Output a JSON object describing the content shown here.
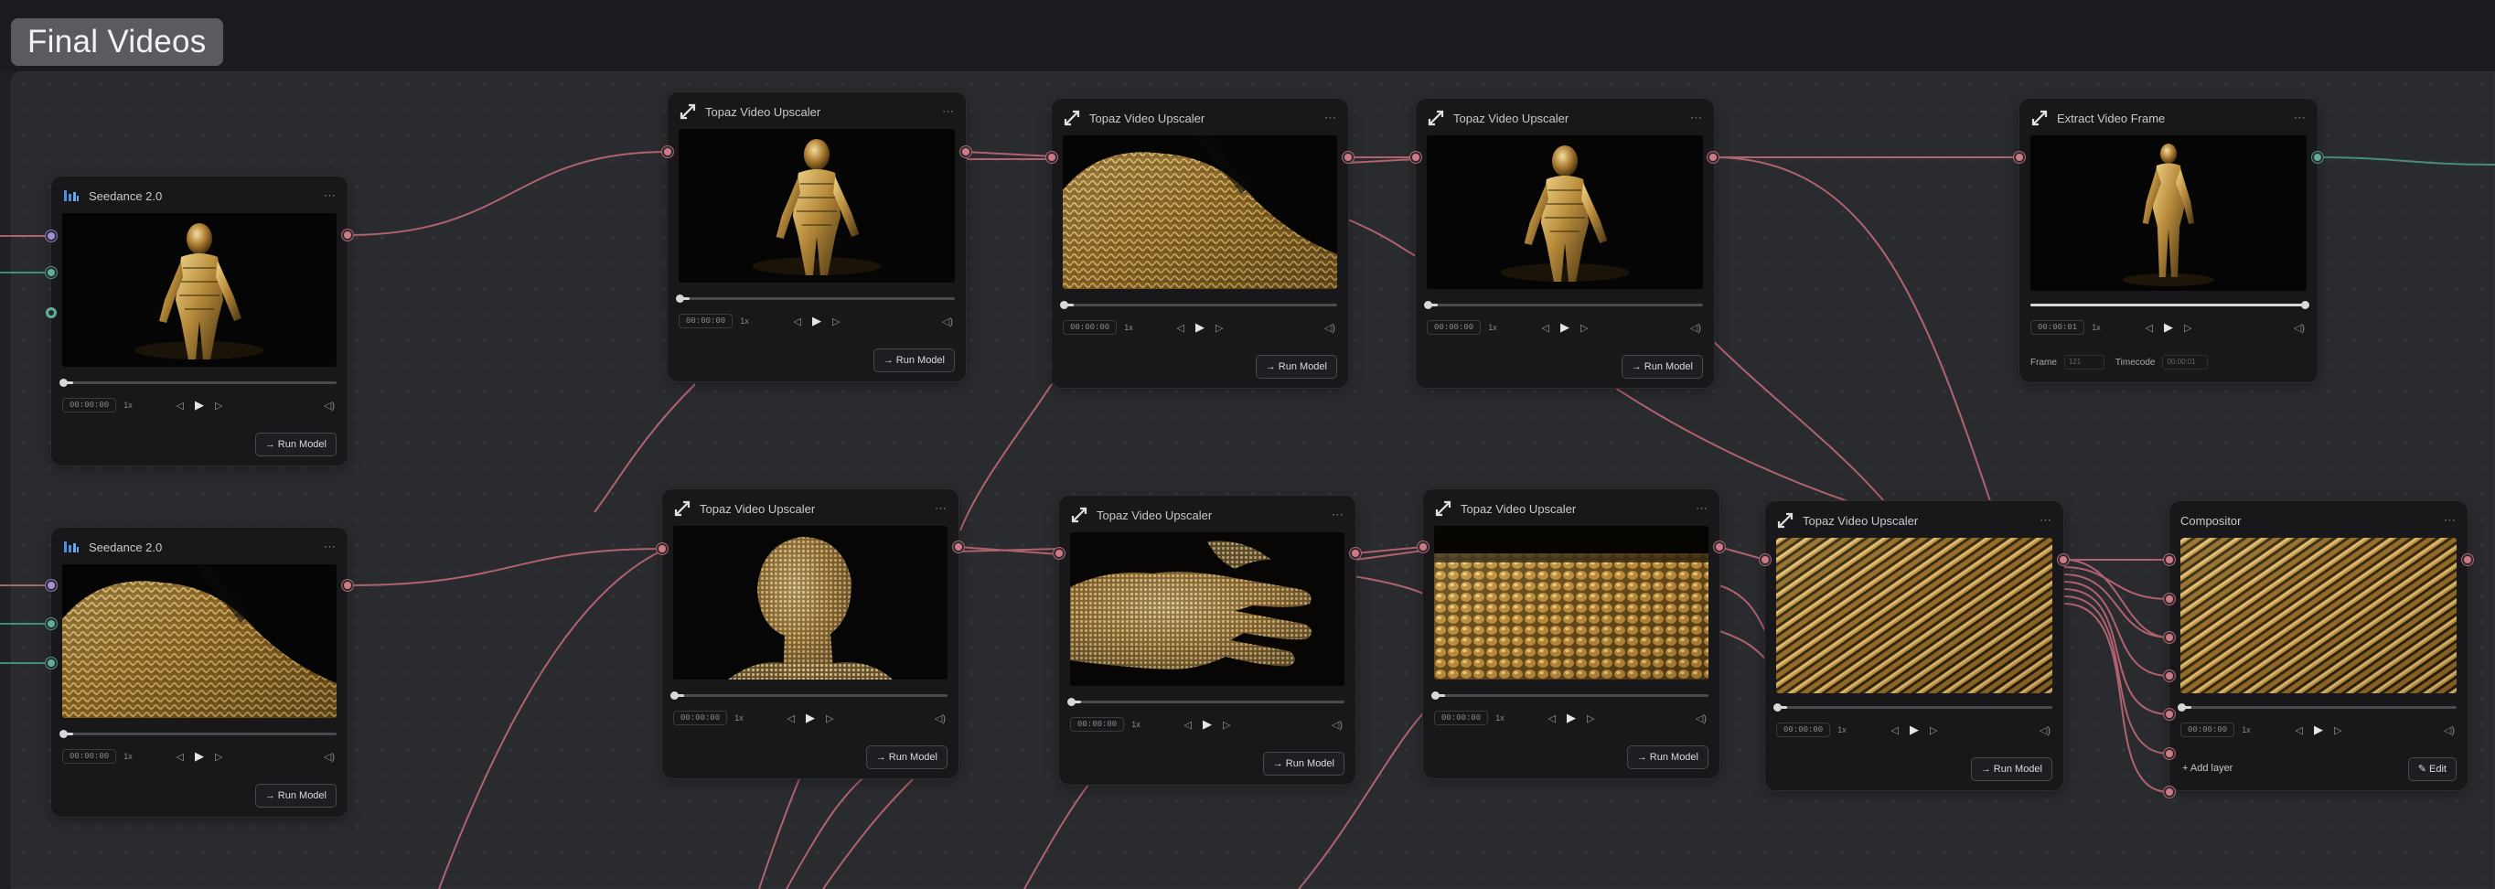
{
  "group": {
    "title": "Final Videos"
  },
  "nodes": [
    {
      "id": "seedance-1",
      "title": "Seedance 2.0",
      "icon": "bar-chart-icon",
      "time": "00:00:00",
      "speed": "1x",
      "button": "→ Run Model",
      "scene": "figure"
    },
    {
      "id": "seedance-2",
      "title": "Seedance 2.0",
      "icon": "bar-chart-icon",
      "time": "00:00:00",
      "speed": "1x",
      "button": "→ Run Model",
      "scene": "shoulder"
    },
    {
      "id": "topaz-1",
      "title": "Topaz Video Upscaler",
      "icon": "upscale-icon",
      "time": "00:00:00",
      "speed": "1x",
      "button": "→ Run Model",
      "scene": "figure"
    },
    {
      "id": "topaz-2",
      "title": "Topaz Video Upscaler",
      "icon": "upscale-icon",
      "time": "00:00:00",
      "speed": "1x",
      "button": "→ Run Model",
      "scene": "shoulder"
    },
    {
      "id": "topaz-3",
      "title": "Topaz Video Upscaler",
      "icon": "upscale-icon",
      "time": "00:00:00",
      "speed": "1x",
      "button": "→ Run Model",
      "scene": "figure"
    },
    {
      "id": "topaz-4",
      "title": "Topaz Video Upscaler",
      "icon": "upscale-icon",
      "time": "00:00:00",
      "speed": "1x",
      "button": "→ Run Model",
      "scene": "head"
    },
    {
      "id": "topaz-5",
      "title": "Topaz Video Upscaler",
      "icon": "upscale-icon",
      "time": "00:00:00",
      "speed": "1x",
      "button": "→ Run Model",
      "scene": "hand"
    },
    {
      "id": "topaz-6",
      "title": "Topaz Video Upscaler",
      "icon": "upscale-icon",
      "time": "00:00:00",
      "speed": "1x",
      "button": "→ Run Model",
      "scene": "texture"
    },
    {
      "id": "topaz-7",
      "title": "Topaz Video Upscaler",
      "icon": "upscale-icon",
      "time": "00:00:00",
      "speed": "1x",
      "button": "→ Run Model",
      "scene": "weave"
    },
    {
      "id": "extract",
      "title": "Extract Video Frame",
      "icon": "upscale-icon",
      "time": "00:00:01",
      "speed": "1x",
      "frame_label": "Frame",
      "frame_value": "121",
      "timecode_label": "Timecode",
      "timecode_value": "00:00:01",
      "scene": "figure-full"
    },
    {
      "id": "compositor",
      "title": "Compositor",
      "time": "00:00:00",
      "speed": "1x",
      "add_layer": "+ Add layer",
      "edit_button": "✎ Edit",
      "scene": "weave"
    }
  ],
  "colors": {
    "wire_red": "#c86c7a",
    "wire_green": "#4f9c88",
    "port_red": "#d17a86",
    "port_green": "#5fae98",
    "port_purple": "#a68fd4",
    "seedance_icon": "#4d8fe0"
  }
}
